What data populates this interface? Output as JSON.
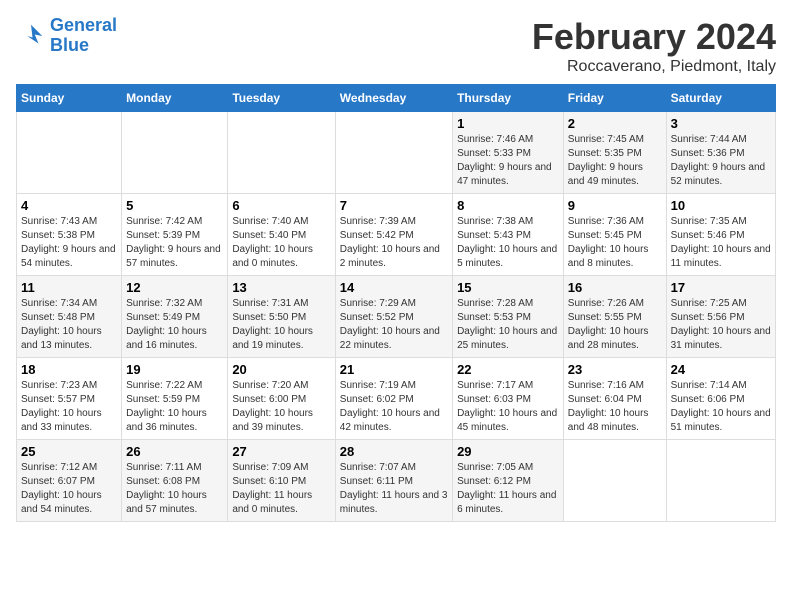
{
  "header": {
    "logo_line1": "General",
    "logo_line2": "Blue",
    "title": "February 2024",
    "subtitle": "Roccaverano, Piedmont, Italy"
  },
  "calendar": {
    "days_of_week": [
      "Sunday",
      "Monday",
      "Tuesday",
      "Wednesday",
      "Thursday",
      "Friday",
      "Saturday"
    ],
    "weeks": [
      [
        {
          "day": "",
          "info": ""
        },
        {
          "day": "",
          "info": ""
        },
        {
          "day": "",
          "info": ""
        },
        {
          "day": "",
          "info": ""
        },
        {
          "day": "1",
          "info": "Sunrise: 7:46 AM\nSunset: 5:33 PM\nDaylight: 9 hours and 47 minutes."
        },
        {
          "day": "2",
          "info": "Sunrise: 7:45 AM\nSunset: 5:35 PM\nDaylight: 9 hours and 49 minutes."
        },
        {
          "day": "3",
          "info": "Sunrise: 7:44 AM\nSunset: 5:36 PM\nDaylight: 9 hours and 52 minutes."
        }
      ],
      [
        {
          "day": "4",
          "info": "Sunrise: 7:43 AM\nSunset: 5:38 PM\nDaylight: 9 hours and 54 minutes."
        },
        {
          "day": "5",
          "info": "Sunrise: 7:42 AM\nSunset: 5:39 PM\nDaylight: 9 hours and 57 minutes."
        },
        {
          "day": "6",
          "info": "Sunrise: 7:40 AM\nSunset: 5:40 PM\nDaylight: 10 hours and 0 minutes."
        },
        {
          "day": "7",
          "info": "Sunrise: 7:39 AM\nSunset: 5:42 PM\nDaylight: 10 hours and 2 minutes."
        },
        {
          "day": "8",
          "info": "Sunrise: 7:38 AM\nSunset: 5:43 PM\nDaylight: 10 hours and 5 minutes."
        },
        {
          "day": "9",
          "info": "Sunrise: 7:36 AM\nSunset: 5:45 PM\nDaylight: 10 hours and 8 minutes."
        },
        {
          "day": "10",
          "info": "Sunrise: 7:35 AM\nSunset: 5:46 PM\nDaylight: 10 hours and 11 minutes."
        }
      ],
      [
        {
          "day": "11",
          "info": "Sunrise: 7:34 AM\nSunset: 5:48 PM\nDaylight: 10 hours and 13 minutes."
        },
        {
          "day": "12",
          "info": "Sunrise: 7:32 AM\nSunset: 5:49 PM\nDaylight: 10 hours and 16 minutes."
        },
        {
          "day": "13",
          "info": "Sunrise: 7:31 AM\nSunset: 5:50 PM\nDaylight: 10 hours and 19 minutes."
        },
        {
          "day": "14",
          "info": "Sunrise: 7:29 AM\nSunset: 5:52 PM\nDaylight: 10 hours and 22 minutes."
        },
        {
          "day": "15",
          "info": "Sunrise: 7:28 AM\nSunset: 5:53 PM\nDaylight: 10 hours and 25 minutes."
        },
        {
          "day": "16",
          "info": "Sunrise: 7:26 AM\nSunset: 5:55 PM\nDaylight: 10 hours and 28 minutes."
        },
        {
          "day": "17",
          "info": "Sunrise: 7:25 AM\nSunset: 5:56 PM\nDaylight: 10 hours and 31 minutes."
        }
      ],
      [
        {
          "day": "18",
          "info": "Sunrise: 7:23 AM\nSunset: 5:57 PM\nDaylight: 10 hours and 33 minutes."
        },
        {
          "day": "19",
          "info": "Sunrise: 7:22 AM\nSunset: 5:59 PM\nDaylight: 10 hours and 36 minutes."
        },
        {
          "day": "20",
          "info": "Sunrise: 7:20 AM\nSunset: 6:00 PM\nDaylight: 10 hours and 39 minutes."
        },
        {
          "day": "21",
          "info": "Sunrise: 7:19 AM\nSunset: 6:02 PM\nDaylight: 10 hours and 42 minutes."
        },
        {
          "day": "22",
          "info": "Sunrise: 7:17 AM\nSunset: 6:03 PM\nDaylight: 10 hours and 45 minutes."
        },
        {
          "day": "23",
          "info": "Sunrise: 7:16 AM\nSunset: 6:04 PM\nDaylight: 10 hours and 48 minutes."
        },
        {
          "day": "24",
          "info": "Sunrise: 7:14 AM\nSunset: 6:06 PM\nDaylight: 10 hours and 51 minutes."
        }
      ],
      [
        {
          "day": "25",
          "info": "Sunrise: 7:12 AM\nSunset: 6:07 PM\nDaylight: 10 hours and 54 minutes."
        },
        {
          "day": "26",
          "info": "Sunrise: 7:11 AM\nSunset: 6:08 PM\nDaylight: 10 hours and 57 minutes."
        },
        {
          "day": "27",
          "info": "Sunrise: 7:09 AM\nSunset: 6:10 PM\nDaylight: 11 hours and 0 minutes."
        },
        {
          "day": "28",
          "info": "Sunrise: 7:07 AM\nSunset: 6:11 PM\nDaylight: 11 hours and 3 minutes."
        },
        {
          "day": "29",
          "info": "Sunrise: 7:05 AM\nSunset: 6:12 PM\nDaylight: 11 hours and 6 minutes."
        },
        {
          "day": "",
          "info": ""
        },
        {
          "day": "",
          "info": ""
        }
      ]
    ]
  }
}
